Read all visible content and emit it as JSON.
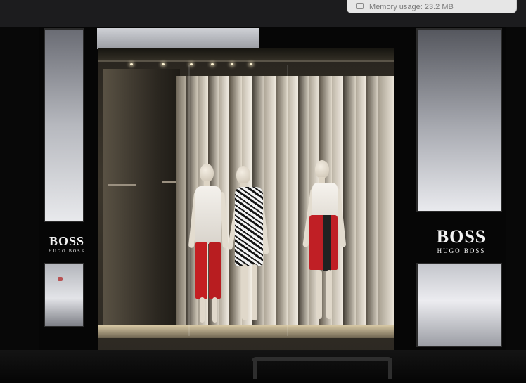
{
  "system_popup": {
    "text": "Memory usage: 23.2 MB",
    "icon": "memory-icon"
  },
  "storefront": {
    "left_sign": {
      "brand": "BOSS",
      "sub": "HUGO BOSS"
    },
    "right_sign": {
      "brand": "BOSS",
      "sub": "HUGO BOSS"
    }
  },
  "colors": {
    "skirt_red": "#c01f25",
    "trouser_red": "#c41f22",
    "top_bar": "#1c1c1e"
  }
}
